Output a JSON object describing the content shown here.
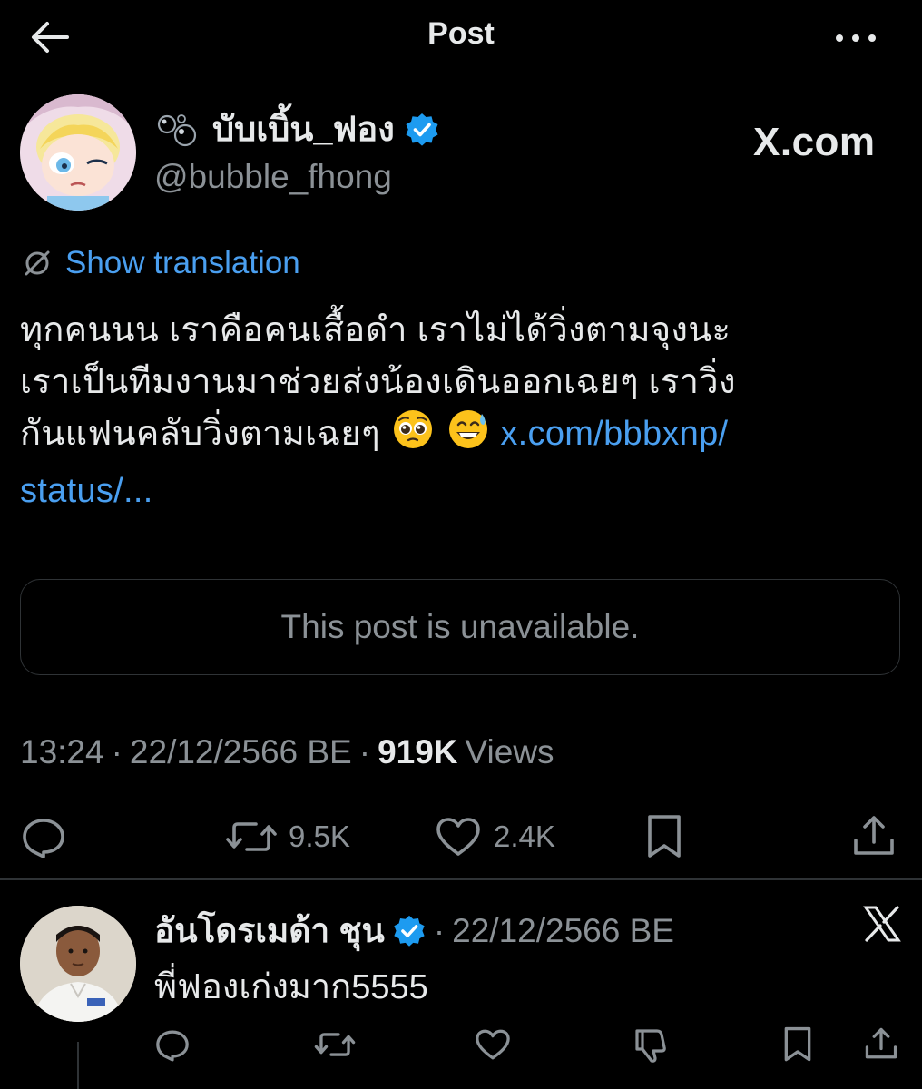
{
  "header": {
    "title": "Post",
    "back_icon": "arrow-left-icon",
    "more_icon": "more-horizontal-icon"
  },
  "author": {
    "display_name": "บับเบิ้น_ฟอง",
    "handle": "@bubble_fhong",
    "verified": true,
    "name_prefix_icon": "bubbles-icon"
  },
  "watermark": "X.com",
  "translation": {
    "label": "Show translation",
    "icon": "translate-slash-icon"
  },
  "post": {
    "line1": "ทุกคนนน เราคือคนเสื้อดำ เราไม่ได้วิ่งตามจุงนะ",
    "line2": "เราเป็นทีมงานมาช่วยส่งน้องเดินออกเฉยๆ เราวิ่ง",
    "line3_text": "กันแฟนคลับวิ่งตามเฉยๆ ",
    "emojis": [
      "pleading-face-emoji",
      "grinning-sweat-emoji"
    ],
    "link_line1": "x.com/bbbxnp/",
    "link_line2": "status/..."
  },
  "quote": {
    "unavailable_text": "This post is unavailable."
  },
  "meta": {
    "time": "13:24",
    "date": "22/12/2566 BE",
    "views_count": "919K",
    "views_label": "Views",
    "separator": "·"
  },
  "actions": {
    "reply_icon": "reply-icon",
    "retweet_icon": "retweet-icon",
    "retweet_count": "9.5K",
    "like_icon": "heart-icon",
    "like_count": "2.4K",
    "bookmark_icon": "bookmark-icon",
    "share_icon": "share-icon"
  },
  "reply": {
    "display_name": "อันโดรเมด้า ชุน",
    "verified": true,
    "separator": "·",
    "date": "22/12/2566 BE",
    "text": "พี่ฟองเก่งมาก5555",
    "source_icon": "x-logo-icon",
    "action_icons": [
      "reply-icon",
      "retweet-icon",
      "heart-icon",
      "dislike-icon",
      "bookmark-icon",
      "share-icon"
    ]
  },
  "colors": {
    "background": "#000000",
    "text": "#e7e9ea",
    "muted": "#8b9196",
    "link": "#4a9ff0",
    "verified": "#1d9bf0",
    "border": "#2f3336"
  }
}
